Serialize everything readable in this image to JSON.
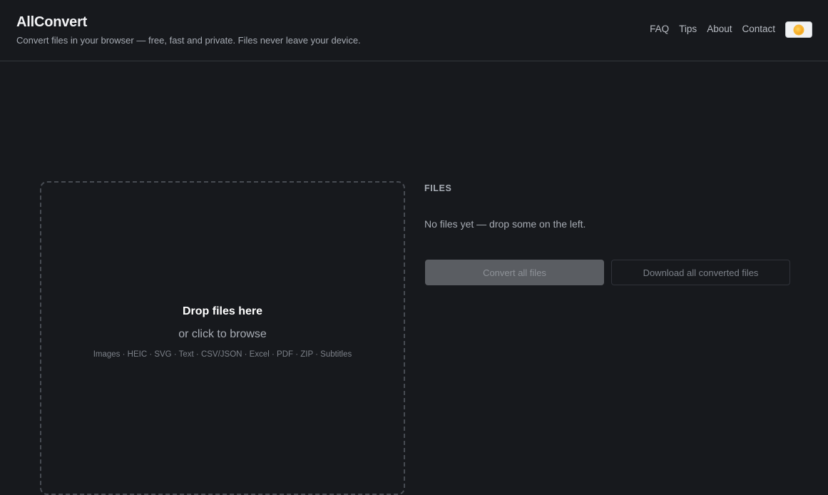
{
  "header": {
    "title": "AllConvert",
    "tagline": "Convert files in your browser — free, fast and private. Files never leave your device.",
    "nav": [
      {
        "label": "FAQ"
      },
      {
        "label": "Tips"
      },
      {
        "label": "About"
      },
      {
        "label": "Contact"
      }
    ],
    "theme_toggle_icon": "sun-icon"
  },
  "dropzone": {
    "title": "Drop files here",
    "subtitle": "or click to browse",
    "supported_types": "Images · HEIC · SVG · Text · CSV/JSON · Excel · PDF · ZIP · Subtitles"
  },
  "files_panel": {
    "heading": "FILES",
    "empty_message": "No files yet — drop some on the left.",
    "convert_all_label": "Convert all files",
    "download_all_label": "Download all converted files"
  },
  "colors": {
    "background": "#17191d",
    "accent_sun": "#f4a21c"
  }
}
